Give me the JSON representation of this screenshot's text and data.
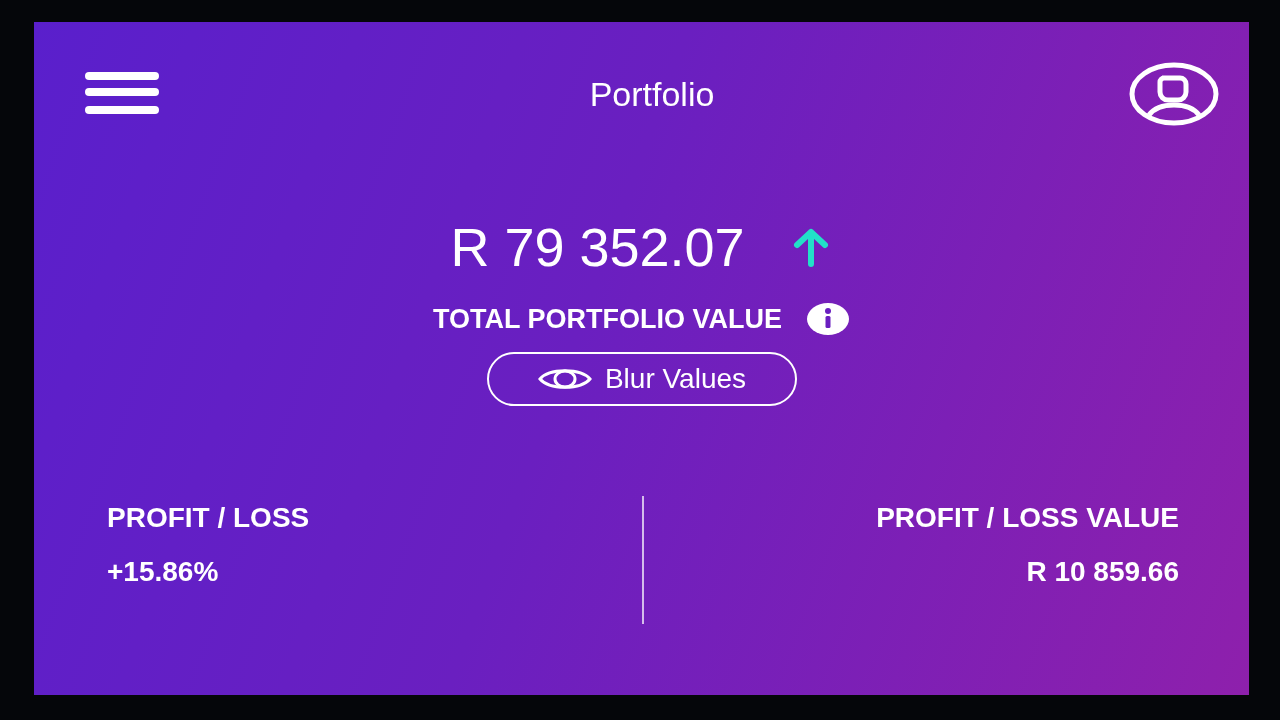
{
  "header": {
    "title": "Portfolio"
  },
  "total": {
    "amount": "R 79 352.07",
    "trend_up": true,
    "label": "TOTAL PORTFOLIO VALUE"
  },
  "blur_button": {
    "label": "Blur Values"
  },
  "stats": [
    {
      "label": "PROFIT / LOSS",
      "value": "+15.86%"
    },
    {
      "label": "PROFIT / LOSS VALUE",
      "value": "R 10 859.66"
    }
  ]
}
